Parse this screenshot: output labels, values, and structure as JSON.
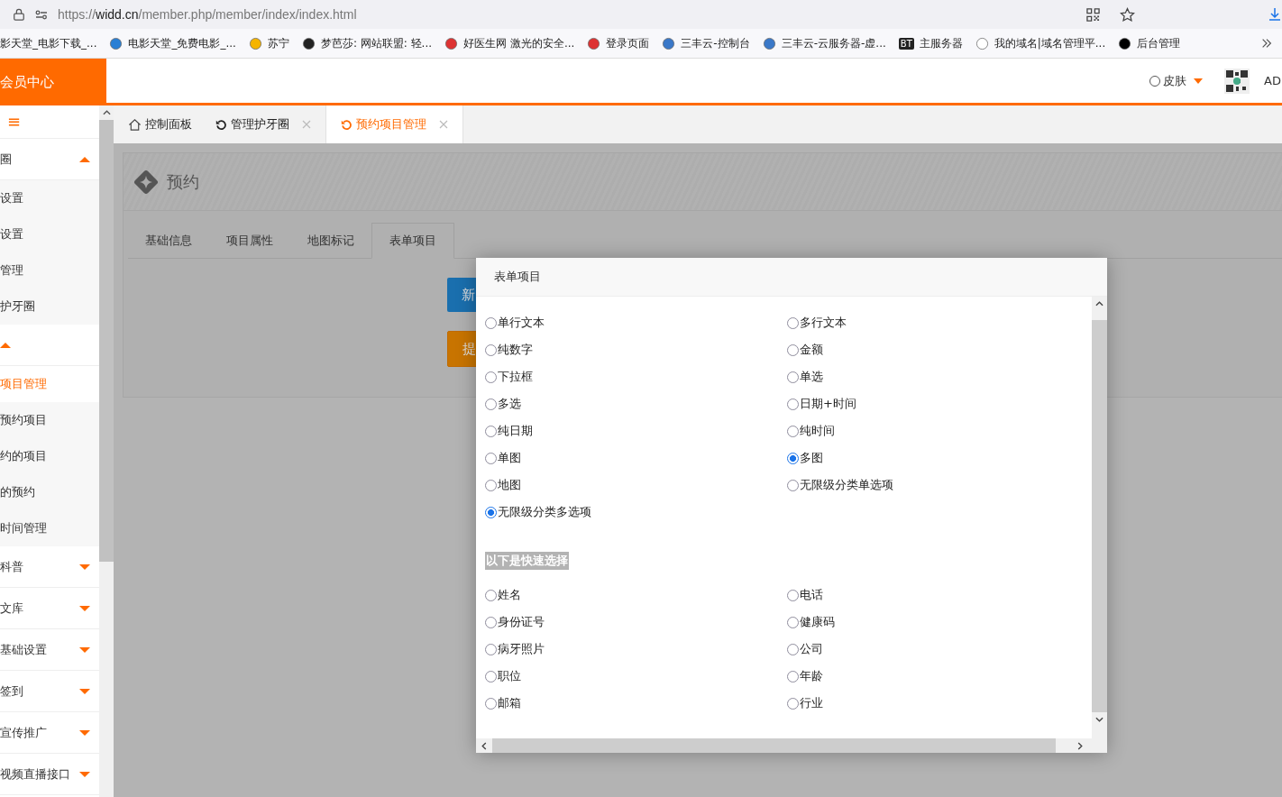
{
  "browser": {
    "url_prefix": "https://",
    "url_domain": "widd.cn",
    "url_path": "/member.php/member/index/index.html",
    "bookmarks": [
      {
        "label": "影天堂_电影下载_..."
      },
      {
        "label": "电影天堂_免费电影_..."
      },
      {
        "label": "苏宁"
      },
      {
        "label": "梦芭莎: 网站联盟: 轻..."
      },
      {
        "label": "好医生网 激光的安全..."
      },
      {
        "label": "登录页面"
      },
      {
        "label": "三丰云-控制台"
      },
      {
        "label": "三丰云-云服务器-虚..."
      },
      {
        "label": "主服务器",
        "icon_text": "BT"
      },
      {
        "label": "我的域名|域名管理平..."
      },
      {
        "label": "后台管理"
      }
    ]
  },
  "header": {
    "logo": "会员中心",
    "skin": "皮肤",
    "user": "AD"
  },
  "sidebar": {
    "menu_icon": "≡",
    "groups": [
      {
        "label": "圈",
        "expanded": true,
        "children": [
          {
            "label": "设置",
            "selected": false
          },
          {
            "label": "设置",
            "selected": false
          },
          {
            "label": "管理",
            "selected": false
          },
          {
            "label": "护牙圈",
            "selected": false
          }
        ]
      },
      {
        "expanded": true,
        "children": [
          {
            "label": "项目管理",
            "selected": true
          },
          {
            "label": "预约项目",
            "selected": false
          },
          {
            "label": "约的项目",
            "selected": false
          },
          {
            "label": "的预约",
            "selected": false
          },
          {
            "label": "时间管理",
            "selected": false
          }
        ]
      },
      {
        "label": "科普",
        "expanded": false
      },
      {
        "label": "文库",
        "expanded": false
      },
      {
        "label": "基础设置",
        "expanded": false
      },
      {
        "label": "签到",
        "expanded": false
      },
      {
        "label": "宣传推广",
        "expanded": false
      },
      {
        "label": "视频直播接口",
        "expanded": false
      }
    ]
  },
  "page_tabs": [
    {
      "label": "控制面板",
      "kind": "home",
      "closable": false,
      "selected": false
    },
    {
      "label": "管理护牙圈",
      "kind": "refresh",
      "closable": true,
      "selected": false
    },
    {
      "label": "预约项目管理",
      "kind": "refresh",
      "closable": true,
      "selected": true
    }
  ],
  "panel": {
    "title": "预约",
    "tabs": [
      {
        "label": "基础信息",
        "selected": false
      },
      {
        "label": "项目属性",
        "selected": false
      },
      {
        "label": "地图标记",
        "selected": false
      },
      {
        "label": "表单项目",
        "selected": true
      }
    ],
    "buttons": [
      {
        "label": "新",
        "kind": "primary"
      },
      {
        "label": "提",
        "kind": "warning"
      }
    ]
  },
  "dialog": {
    "title": "表单项目",
    "sections": [
      {
        "options": [
          {
            "label": "单行文本",
            "selected": false
          },
          {
            "label": "多行文本",
            "selected": false
          },
          {
            "label": "纯数字",
            "selected": false
          },
          {
            "label": "金额",
            "selected": false
          },
          {
            "label": "下拉框",
            "selected": false
          },
          {
            "label": "单选",
            "selected": false
          },
          {
            "label": "多选",
            "selected": false
          },
          {
            "label": "日期+时间",
            "selected": false
          },
          {
            "label": "纯日期",
            "selected": false
          },
          {
            "label": "纯时间",
            "selected": false
          },
          {
            "label": "单图",
            "selected": false
          },
          {
            "label": "多图",
            "selected": true
          },
          {
            "label": "地图",
            "selected": false
          },
          {
            "label": "无限级分类单选项",
            "selected": false
          },
          {
            "label": "无限级分类多选项",
            "selected": true
          }
        ]
      },
      {
        "title": "以下是快速选择",
        "options": [
          {
            "label": "姓名",
            "selected": false
          },
          {
            "label": "电话",
            "selected": false
          },
          {
            "label": "身份证号",
            "selected": false
          },
          {
            "label": "健康码",
            "selected": false
          },
          {
            "label": "病牙照片",
            "selected": false
          },
          {
            "label": "公司",
            "selected": false
          },
          {
            "label": "职位",
            "selected": false
          },
          {
            "label": "年龄",
            "selected": false
          },
          {
            "label": "邮箱",
            "selected": false
          },
          {
            "label": "行业",
            "selected": false
          }
        ]
      }
    ]
  }
}
